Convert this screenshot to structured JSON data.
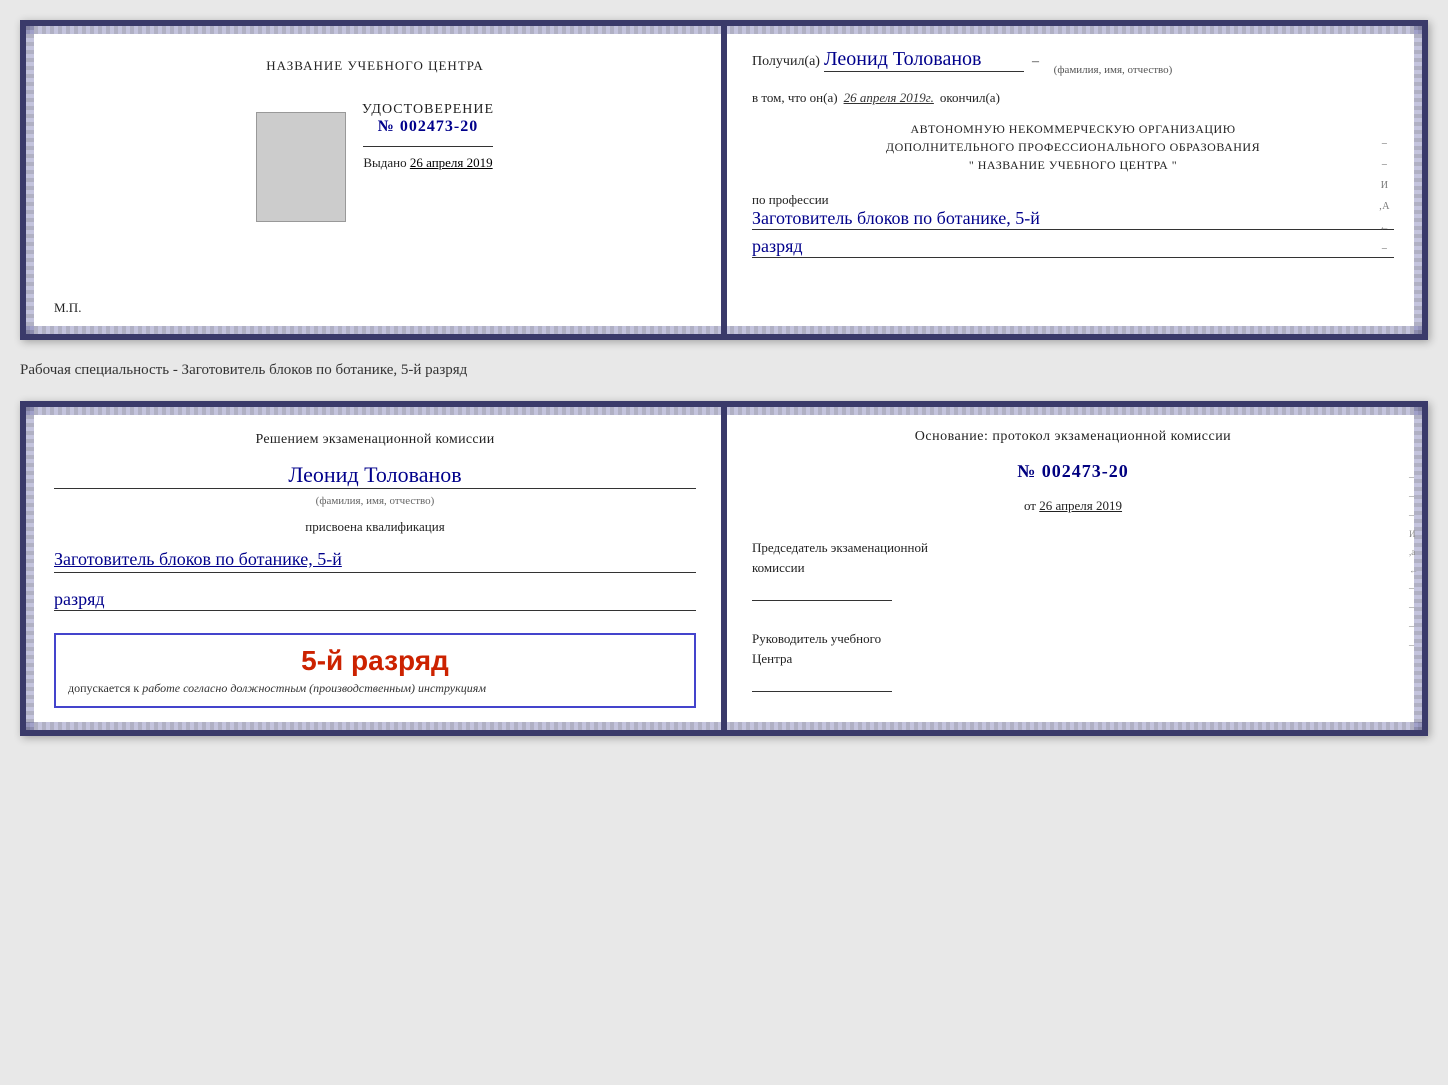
{
  "page": {
    "background": "#e8e8e8"
  },
  "cert1": {
    "left": {
      "training_center_label": "НАЗВАНИЕ УЧЕБНОГО ЦЕНТРА",
      "udostoverenie_title": "УДОСТОВЕРЕНИЕ",
      "cert_number_prefix": "№",
      "cert_number": "002473-20",
      "vydano_label": "Выдано",
      "vydano_date": "26 апреля 2019",
      "mp_label": "М.П."
    },
    "right": {
      "poluchil_label": "Получил(а)",
      "poluchil_name": "Леонид Толованов",
      "poluchil_dash": "–",
      "fio_label": "(фамилия, имя, отчество)",
      "vtom_label": "в том, что он(а)",
      "vtom_date": "26 апреля 2019г.",
      "okonchl_label": "окончил(а)",
      "org_line1": "АВТОНОМНУЮ НЕКОММЕРЧЕСКУЮ ОРГАНИЗАЦИЮ",
      "org_line2": "ДОПОЛНИТЕЛЬНОГО ПРОФЕССИОНАЛЬНОГО ОБРАЗОВАНИЯ",
      "org_line3": "\"  НАЗВАНИЕ УЧЕБНОГО ЦЕНТРА  \"",
      "po_professii_label": "по профессии",
      "professiya": "Заготовитель блоков по ботанике, 5-й",
      "razryad": "разряд"
    }
  },
  "specialty_label": "Рабочая специальность - Заготовитель блоков по ботанике, 5-й разряд",
  "cert2": {
    "left": {
      "resheniem_line1": "Решением экзаменационной комиссии",
      "person_name": "Леонид Толованов",
      "fio_label": "(фамилия, имя, отчество)",
      "prisvoyena_text": "присвоена квалификация",
      "qualification": "Заготовитель блоков по ботанике, 5-й",
      "razryad": "разряд",
      "stamp_rank": "5-й разряд",
      "dopuskaetsya_prefix": "допускается к",
      "dopuskaetsya_italic": "работе согласно должностным (производственным) инструкциям"
    },
    "right": {
      "osnovanie_text": "Основание: протокол экзаменационной комиссии",
      "protocol_number_prefix": "№",
      "protocol_number": "002473-20",
      "ot_label": "от",
      "ot_date": "26 апреля 2019",
      "predsedatel_line1": "Председатель экзаменационной",
      "predsedatel_line2": "комиссии",
      "rukovoditel_line1": "Руководитель учебного",
      "rukovoditel_line2": "Центра"
    }
  },
  "icons": {
    "decorative": "■"
  }
}
